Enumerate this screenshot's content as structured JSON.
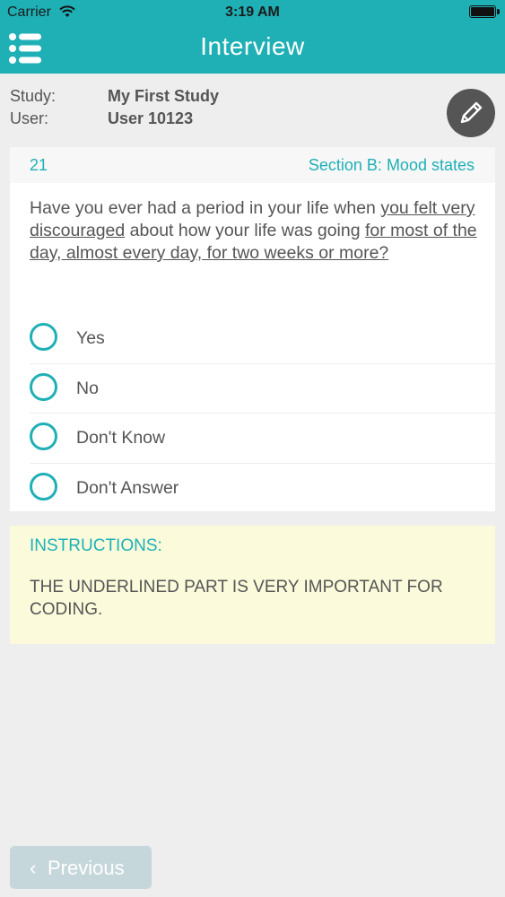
{
  "status": {
    "carrier": "Carrier",
    "time": "3:19 AM"
  },
  "navbar": {
    "title": "Interview",
    "menu_icon": "list-menu-icon"
  },
  "info": {
    "study_label": "Study:",
    "study_value": "My First Study",
    "user_label": "User:",
    "user_value": "User 10123",
    "edit_icon": "pencil-icon"
  },
  "question": {
    "number": "21",
    "section": "Section B: Mood states",
    "text_parts": [
      "Have you ever had a period in your life when ",
      "you felt very discouraged",
      " about how your life was going ",
      "for most of the day, almost every day, for two weeks or more?"
    ],
    "options": [
      {
        "label": "Yes"
      },
      {
        "label": "No"
      },
      {
        "label": "Don't Know"
      },
      {
        "label": "Don't Answer"
      }
    ]
  },
  "instructions": {
    "title": "INSTRUCTIONS:",
    "text": "THE UNDERLINED PART IS VERY IMPORTANT FOR CODING."
  },
  "footer": {
    "previous_label": "Previous",
    "previous_icon": "chevron-left-icon"
  },
  "colors": {
    "accent": "#1fb0b6",
    "background": "#eeeeee",
    "instructions_bg": "#fbfbdc",
    "button_disabled": "#c6d7dc"
  }
}
